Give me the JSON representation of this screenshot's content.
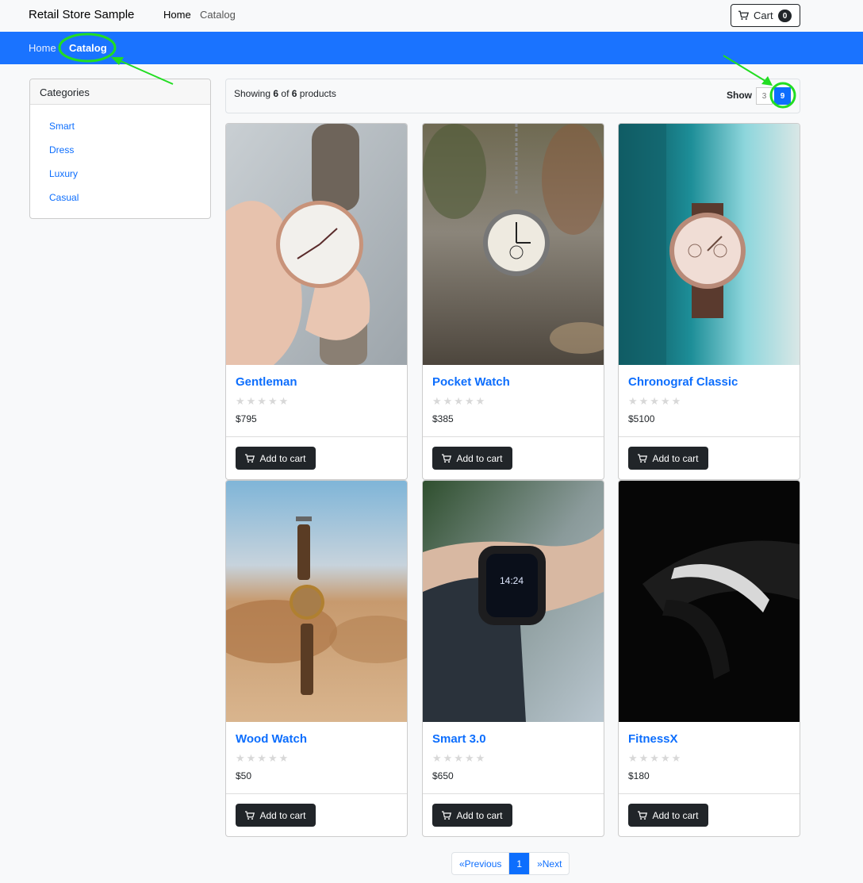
{
  "navbar": {
    "brand": "Retail Store Sample",
    "links": [
      "Home",
      "Catalog"
    ],
    "cart_label": "Cart",
    "cart_count": "0"
  },
  "breadcrumb": {
    "items": [
      "Home",
      "Catalog"
    ]
  },
  "sidebar": {
    "title": "Categories",
    "items": [
      "Smart",
      "Dress",
      "Luxury",
      "Casual"
    ]
  },
  "toolbar": {
    "showing_prefix": "Showing",
    "shown_count": "6",
    "of_text": "of",
    "total_count": "6",
    "products_text": "products",
    "show_label": "Show",
    "show_options": [
      "3",
      "9"
    ],
    "selected_option": "9"
  },
  "products": [
    {
      "name": "Gentleman",
      "price": "$795",
      "rating": 0,
      "button": "Add to cart"
    },
    {
      "name": "Pocket Watch",
      "price": "$385",
      "rating": 0,
      "button": "Add to cart"
    },
    {
      "name": "Chronograf Classic",
      "price": "$5100",
      "rating": 0,
      "button": "Add to cart"
    },
    {
      "name": "Wood Watch",
      "price": "$50",
      "rating": 0,
      "button": "Add to cart"
    },
    {
      "name": "Smart 3.0",
      "price": "$650",
      "rating": 0,
      "button": "Add to cart"
    },
    {
      "name": "FitnessX",
      "price": "$180",
      "rating": 0,
      "button": "Add to cart"
    }
  ],
  "pagination": {
    "previous": "«Previous",
    "current": "1",
    "next": "»Next"
  },
  "colors": {
    "accent": "#1a73ff",
    "link": "#0d6efd",
    "annotation": "#22dd22",
    "dark": "#212529"
  }
}
